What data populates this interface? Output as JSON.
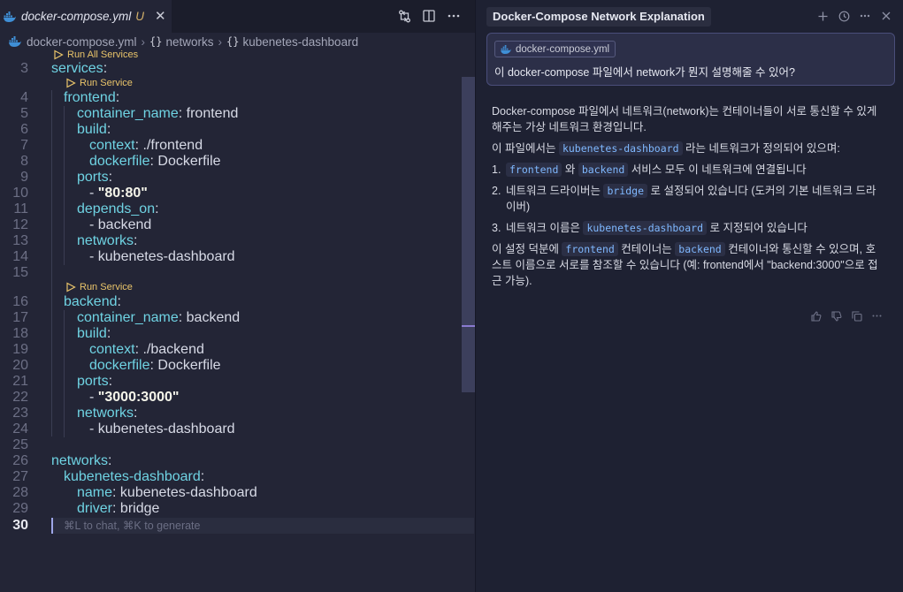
{
  "editor": {
    "tab": {
      "filename": "docker-compose.yml",
      "status": "U",
      "close": "✕"
    },
    "breadcrumb": {
      "file": "docker-compose.yml",
      "items": [
        "networks",
        "kubenetes-dashboard"
      ],
      "braces": "{}"
    },
    "codelens": {
      "run_all": "Run All Services",
      "run_service": "Run Service"
    },
    "lines": [
      {
        "n": "3",
        "key": "services",
        "val": ""
      },
      {
        "n": "4",
        "key": "frontend",
        "val": ""
      },
      {
        "n": "5",
        "key": "container_name",
        "val": " frontend"
      },
      {
        "n": "6",
        "key": "build",
        "val": ""
      },
      {
        "n": "7",
        "key": "context",
        "val": " ./frontend"
      },
      {
        "n": "8",
        "key": "dockerfile",
        "val": " Dockerfile"
      },
      {
        "n": "9",
        "key": "ports",
        "val": ""
      },
      {
        "n": "10",
        "item": "\"80:80\""
      },
      {
        "n": "11",
        "key": "depends_on",
        "val": ""
      },
      {
        "n": "12",
        "item": "backend"
      },
      {
        "n": "13",
        "key": "networks",
        "val": ""
      },
      {
        "n": "14",
        "item": "kubenetes-dashboard"
      },
      {
        "n": "15"
      },
      {
        "n": "16",
        "key": "backend",
        "val": ""
      },
      {
        "n": "17",
        "key": "container_name",
        "val": " backend"
      },
      {
        "n": "18",
        "key": "build",
        "val": ""
      },
      {
        "n": "19",
        "key": "context",
        "val": " ./backend"
      },
      {
        "n": "20",
        "key": "dockerfile",
        "val": " Dockerfile"
      },
      {
        "n": "21",
        "key": "ports",
        "val": ""
      },
      {
        "n": "22",
        "item": "\"3000:3000\""
      },
      {
        "n": "23",
        "key": "networks",
        "val": ""
      },
      {
        "n": "24",
        "item": "kubenetes-dashboard"
      },
      {
        "n": "25"
      },
      {
        "n": "26",
        "key": "networks",
        "val": ""
      },
      {
        "n": "27",
        "key": "kubenetes-dashboard",
        "val": ""
      },
      {
        "n": "28",
        "key": "name",
        "val": " kubenetes-dashboard"
      },
      {
        "n": "29",
        "key": "driver",
        "val": " bridge"
      },
      {
        "n": "30"
      }
    ],
    "current_line_hint": "⌘L to chat, ⌘K to generate"
  },
  "chat": {
    "title": "Docker-Compose Network Explanation",
    "prompt": {
      "file_chip": "docker-compose.yml",
      "text": "이 docker-compose 파일에서 network가 뭔지 설명해줄 수 있어?"
    },
    "answer": {
      "intro": "Docker-compose 파일에서 네트워크(network)는 컨테이너들이 서로 통신할 수 있게 해주는 가상 네트워크 환경입니다.",
      "defined_pre": "이 파일에서는 ",
      "defined_code": "kubenetes-dashboard",
      "defined_post": " 라는 네트워크가 정의되어 있으며:",
      "items": [
        {
          "num": "1.",
          "code1": "frontend",
          "mid": " 와 ",
          "code2": "backend",
          "post": " 서비스 모두 이 네트워크에 연결됩니다"
        },
        {
          "num": "2.",
          "pre": "네트워크 드라이버는 ",
          "code1": "bridge",
          "post": " 로 설정되어 있습니다 (도커의 기본 네트워크 드라이버)"
        },
        {
          "num": "3.",
          "pre": "네트워크 이름은 ",
          "code1": "kubenetes-dashboard",
          "post": " 로 지정되어 있습니다"
        }
      ],
      "outro_pre": "이 설정 덕분에 ",
      "outro_code1": "frontend",
      "outro_mid": " 컨테이너는 ",
      "outro_code2": "backend",
      "outro_post": " 컨테이너와 통신할 수 있으며, 호스트 이름으로 서로를 참조할 수 있습니다 (예: frontend에서 \"backend:3000\"으로 접근 가능)."
    }
  }
}
